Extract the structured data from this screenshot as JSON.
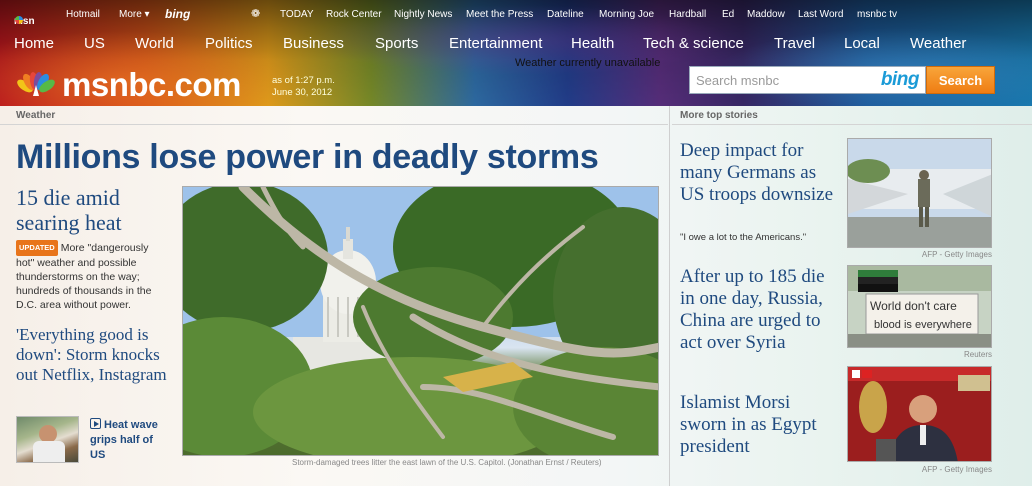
{
  "topbar": {
    "msn": "msn",
    "hotmail": "Hotmail",
    "more": "More ▾",
    "bing": "bing",
    "links": [
      "TODAY",
      "Rock Center",
      "Nightly News",
      "Meet the Press",
      "Dateline",
      "Morning Joe",
      "Hardball",
      "Ed",
      "Maddow",
      "Last Word",
      "msnbc tv"
    ]
  },
  "nav": [
    "Home",
    "US",
    "World",
    "Politics",
    "Business",
    "Sports",
    "Entertainment",
    "Health",
    "Tech & science",
    "Travel",
    "Local",
    "Weather"
  ],
  "brand": {
    "name": "msnbc.com",
    "asof_line1": "as of 1:27 p.m.",
    "asof_line2": "June 30, 2012"
  },
  "weather_message": "Weather currently unavailable",
  "search": {
    "placeholder": "Search msnbc",
    "engine": "bing",
    "button": "Search"
  },
  "sections": {
    "left": "Weather",
    "right": "More top stories"
  },
  "lead": {
    "headline": "Millions lose power in deadly storms",
    "sub1_title": "15 die amid searing heat",
    "badge": "UPDATED",
    "sub1_text": "More \"dangerously hot\" weather and possible thunderstorms on the way; hundreds of thousands in the D.C. area without power.",
    "sub2_title": "'Everything good is down': Storm knocks out Netflix, Instagram",
    "video_link": "Heat wave grips half of US",
    "caption": "Storm-damaged trees litter the east lawn of the U.S. Capitol. (Jonathan Ernst / Reuters)"
  },
  "stories": [
    {
      "title": "Deep impact for many Germans as US troops downsize",
      "quote": "\"I owe a lot to the Americans.\"",
      "credit": "AFP - Getty Images"
    },
    {
      "title": "After up to 185 die in one day, Russia, China are urged to act over Syria",
      "credit": "Reuters",
      "sign_text_1": "World don't care",
      "sign_text_2": "blood is everywhere"
    },
    {
      "title": "Islamist Morsi sworn in as Egypt president",
      "credit": "AFP - Getty Images"
    }
  ]
}
